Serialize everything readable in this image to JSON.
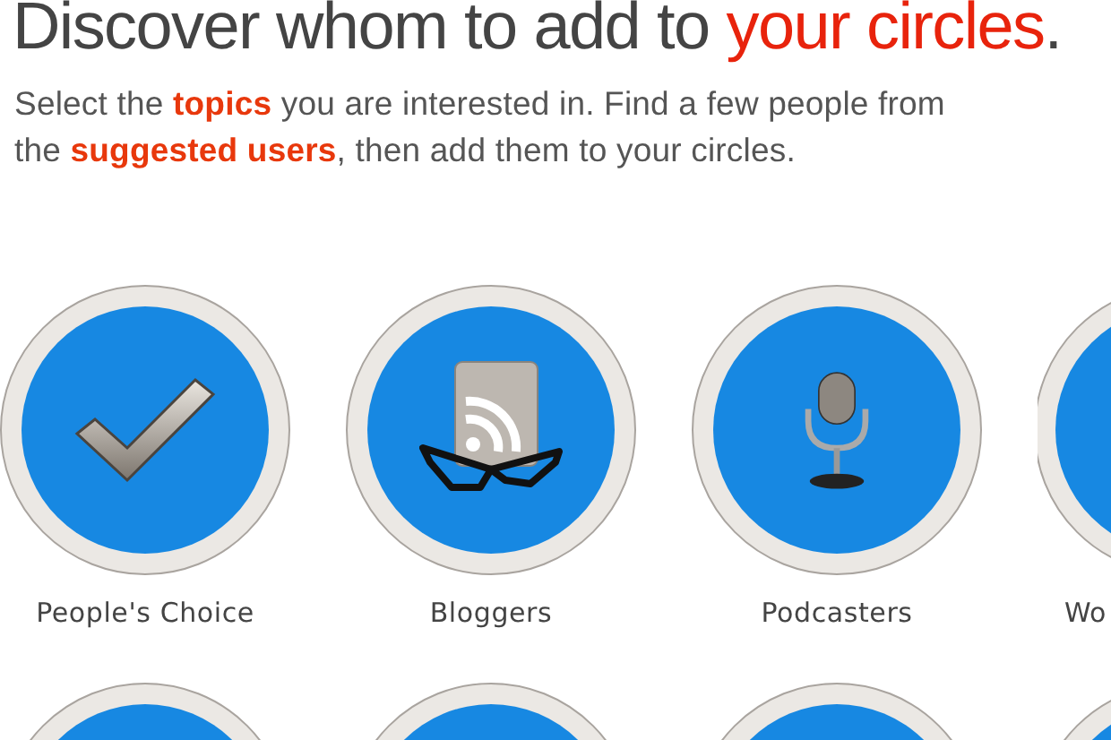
{
  "heading": {
    "text": "Discover whom to add to ",
    "highlight": "your circles",
    "end": "."
  },
  "intro": [
    "Select the **topics** you are interested in. Find a few people from",
    "the **suggested users**, then add them to your circles."
  ],
  "topics": [
    {
      "label": "People's Choice",
      "kind": "check"
    },
    {
      "label": "Bloggers",
      "kind": "rss"
    },
    {
      "label": "Podcasters",
      "kind": "microphone"
    },
    {
      "label": "Wo",
      "kind": "none"
    },
    {
      "kind": "none"
    },
    {
      "kind": "none"
    },
    {
      "kind": "none"
    },
    {
      "kind": "none"
    }
  ]
}
